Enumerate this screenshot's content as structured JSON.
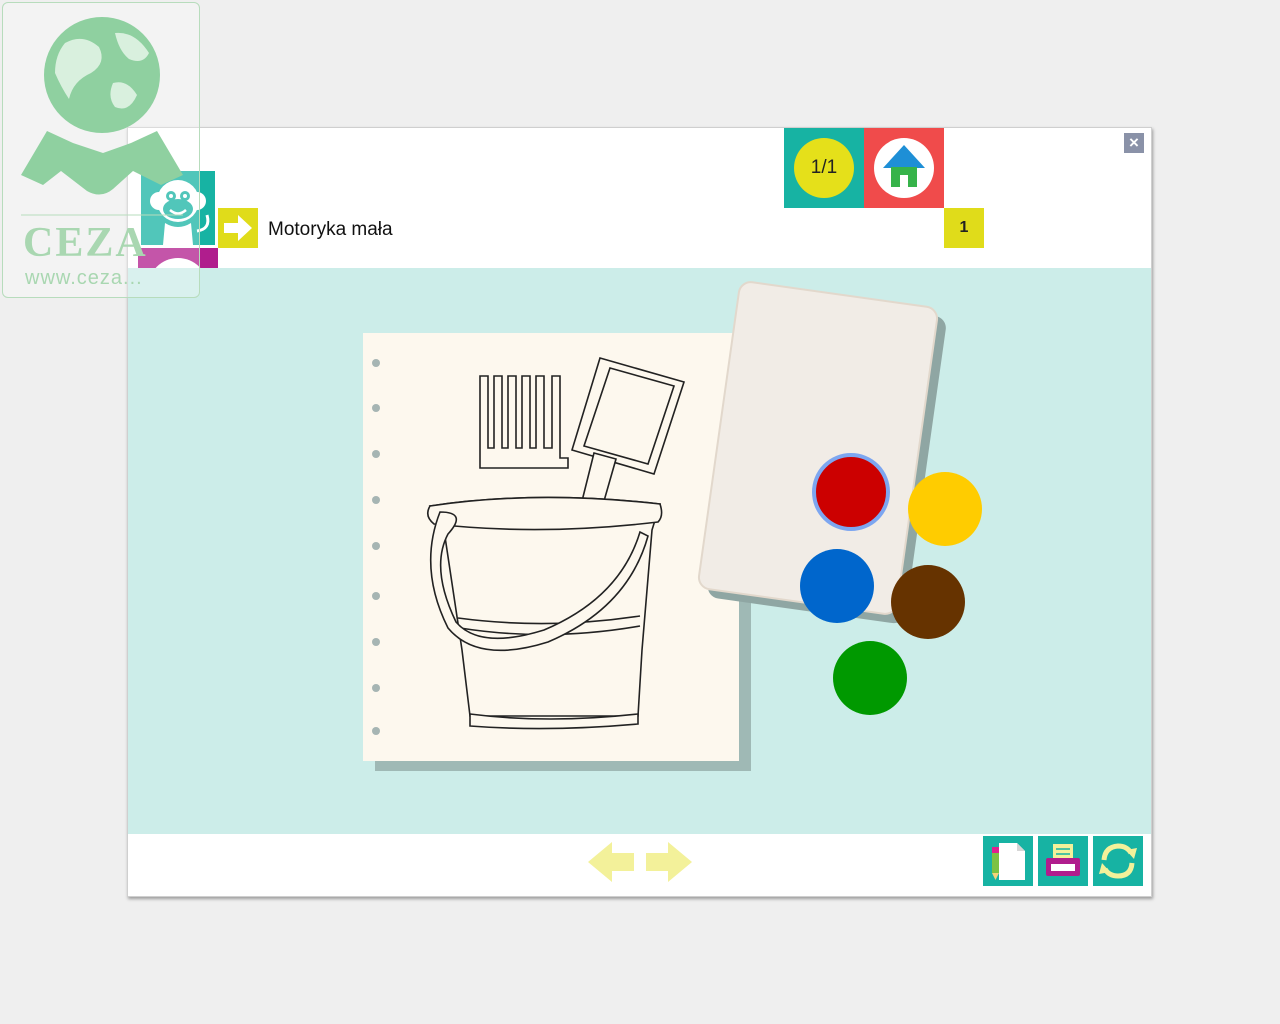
{
  "watermark": {
    "name": "CEZA",
    "url": "www.ceza..."
  },
  "header": {
    "page_indicator": "1/1",
    "counter": "1",
    "title": "Motoryka mała",
    "close_symbol": "×"
  },
  "icons": {
    "close": "close-icon",
    "home": "home-icon",
    "mascot": "monkey-icon",
    "sound": "speaker-icon",
    "title_arrow": "arrow-right-icon",
    "prev": "arrow-left-icon",
    "next": "arrow-right-icon",
    "tools": [
      "pencil-page-icon",
      "print-icon",
      "refresh-icon"
    ]
  },
  "colors": {
    "teal": "#17b3a3",
    "red_tile": "#f04b4b",
    "yellow": "#e0dc1a",
    "magenta": "#b01d8d",
    "canvas_bg": "#ccede9",
    "nav_arrow": "#f3f19a"
  },
  "palette": {
    "selected": "red",
    "colors": [
      {
        "name": "red",
        "hex": "#cc0000"
      },
      {
        "name": "yellow",
        "hex": "#ffcc00"
      },
      {
        "name": "blue",
        "hex": "#0066cc"
      },
      {
        "name": "brown",
        "hex": "#663300"
      },
      {
        "name": "green",
        "hex": "#009900"
      }
    ]
  },
  "drawing": {
    "subject": "bucket-with-rake-and-shovel"
  }
}
